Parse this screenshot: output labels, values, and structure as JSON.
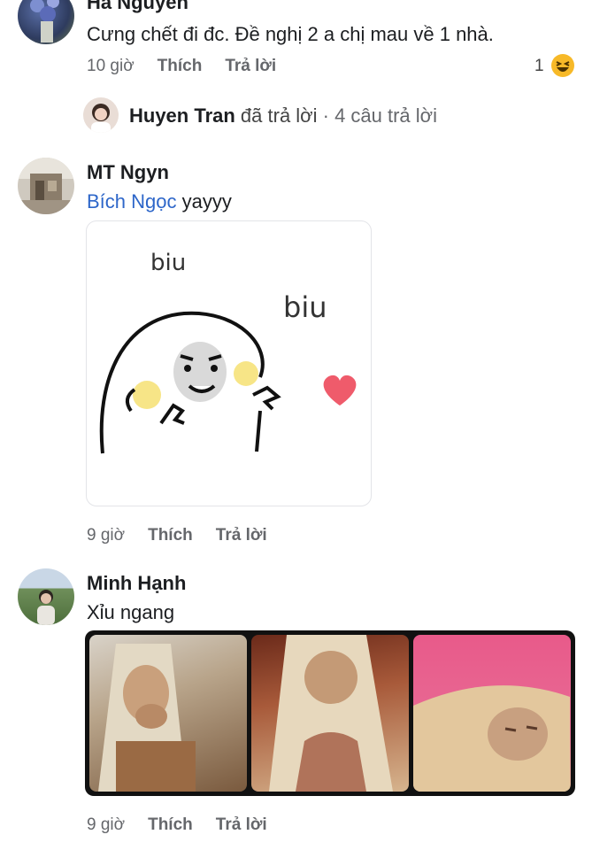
{
  "comments": [
    {
      "author": "Ha Nguyen",
      "text": "Cưng chết đi đc. Đề nghị 2 a chị mau về 1 nhà.",
      "time": "10 giờ",
      "like_label": "Thích",
      "reply_label": "Trả lời",
      "reaction_count": "1"
    },
    {
      "author": "MT Ngyn",
      "mention": "Bích Ngọc",
      "text": " yayyy",
      "sticker_text_1": "biu",
      "sticker_text_2": "biu",
      "time": "9 giờ",
      "like_label": "Thích",
      "reply_label": "Trả lời"
    },
    {
      "author": "Minh Hạnh",
      "text": "Xỉu ngang",
      "time": "9 giờ",
      "like_label": "Thích",
      "reply_label": "Trả lời"
    }
  ],
  "replies_summary": {
    "author": "Huyen Tran",
    "action": " đã trả lời",
    "separator": " · ",
    "count": "4 câu trả lời"
  },
  "colors": {
    "mention": "#2d66c9",
    "meta": "#65676b",
    "heart": "#ef5b6b",
    "haha_emoji": "#f7b928"
  },
  "icons": [
    "haha-emoji-icon",
    "heart-icon"
  ]
}
